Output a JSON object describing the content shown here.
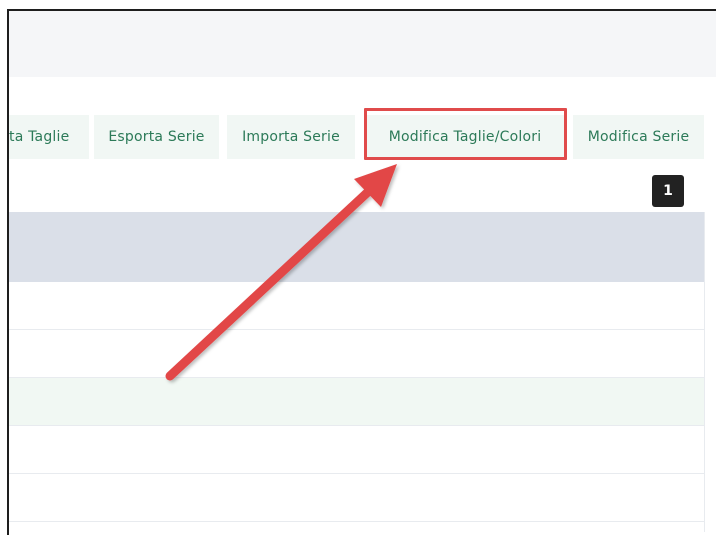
{
  "toolbar": {
    "buttons": [
      {
        "label": "ta Taglie"
      },
      {
        "label": "Esporta Serie"
      },
      {
        "label": "Importa Serie"
      },
      {
        "label": "Modifica Taglie/Colori"
      },
      {
        "label": "Modifica Serie"
      }
    ]
  },
  "pagination": {
    "current_page": "1"
  },
  "colors": {
    "accent_text": "#2c7a58",
    "button_bg": "#f1f7f4",
    "highlight": "#e04b4b",
    "table_header": "#dadfe8",
    "row_alt": "#f1f8f3"
  },
  "icons": {
    "annotation": "red-arrow-icon"
  }
}
